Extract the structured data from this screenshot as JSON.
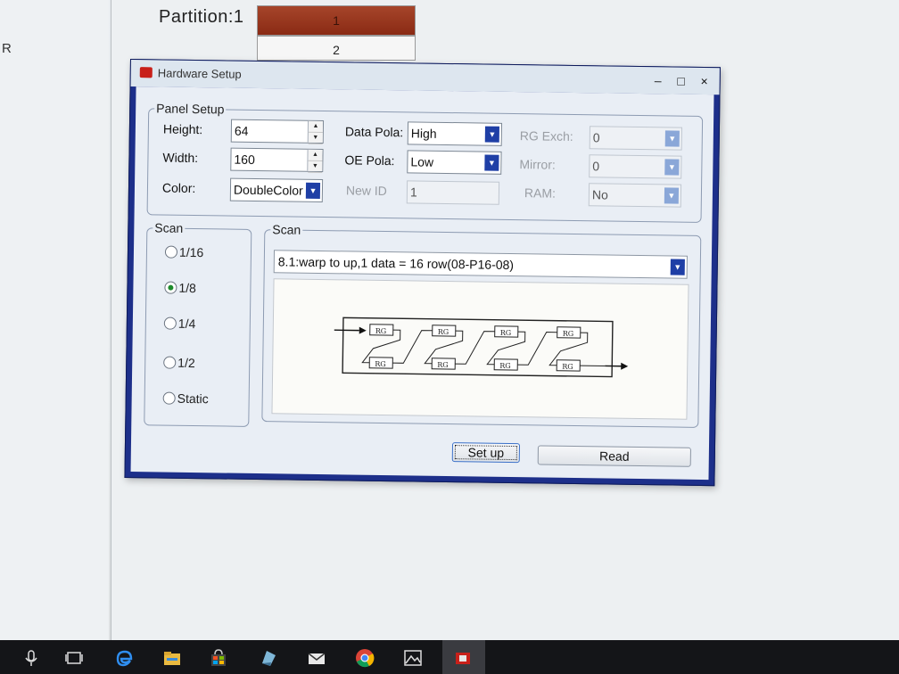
{
  "background": {
    "left_letter": "R",
    "partition_label": "Partition:1",
    "partitions": [
      "1",
      "2"
    ]
  },
  "dialog": {
    "title": "Hardware Setup",
    "controls": {
      "minimize": "–",
      "maximize": "□",
      "close": "×"
    },
    "panel_setup": {
      "legend": "Panel Setup",
      "height": {
        "label": "Height:",
        "value": "64"
      },
      "width": {
        "label": "Width:",
        "value": "160"
      },
      "color": {
        "label": "Color:",
        "value": "DoubleColor"
      },
      "data_pola": {
        "label": "Data Pola:",
        "value": "High"
      },
      "oe_pola": {
        "label": "OE Pola:",
        "value": "Low"
      },
      "new_id": {
        "label": "New ID",
        "value": "1"
      },
      "rg_exch": {
        "label": "RG Exch:",
        "value": "0"
      },
      "mirror": {
        "label": "Mirror:",
        "value": "0"
      },
      "ram": {
        "label": "RAM:",
        "value": "No"
      }
    },
    "scan_mode": {
      "legend": "Scan",
      "options": [
        "1/16",
        "1/8",
        "1/4",
        "1/2",
        "Static"
      ],
      "selected": "1/8"
    },
    "scan_detail": {
      "legend": "Scan",
      "selected": "8.1:warp to up,1 data = 16 row(08-P16-08)",
      "module_label": "RG"
    },
    "buttons": {
      "setup": "Set up",
      "read": "Read"
    }
  },
  "taskbar": {
    "icons": [
      "mic-icon",
      "task-view-icon",
      "edge-icon",
      "file-explorer-icon",
      "store-icon",
      "app-icon",
      "mail-icon",
      "chrome-icon",
      "photos-icon",
      "led-app-icon"
    ]
  },
  "colors": {
    "dialog_frame": "#1d2f8a",
    "partition_active": "#9a3920",
    "dropdown_accent": "#1f3fa6",
    "radio_selected": "#1d8a2b"
  }
}
